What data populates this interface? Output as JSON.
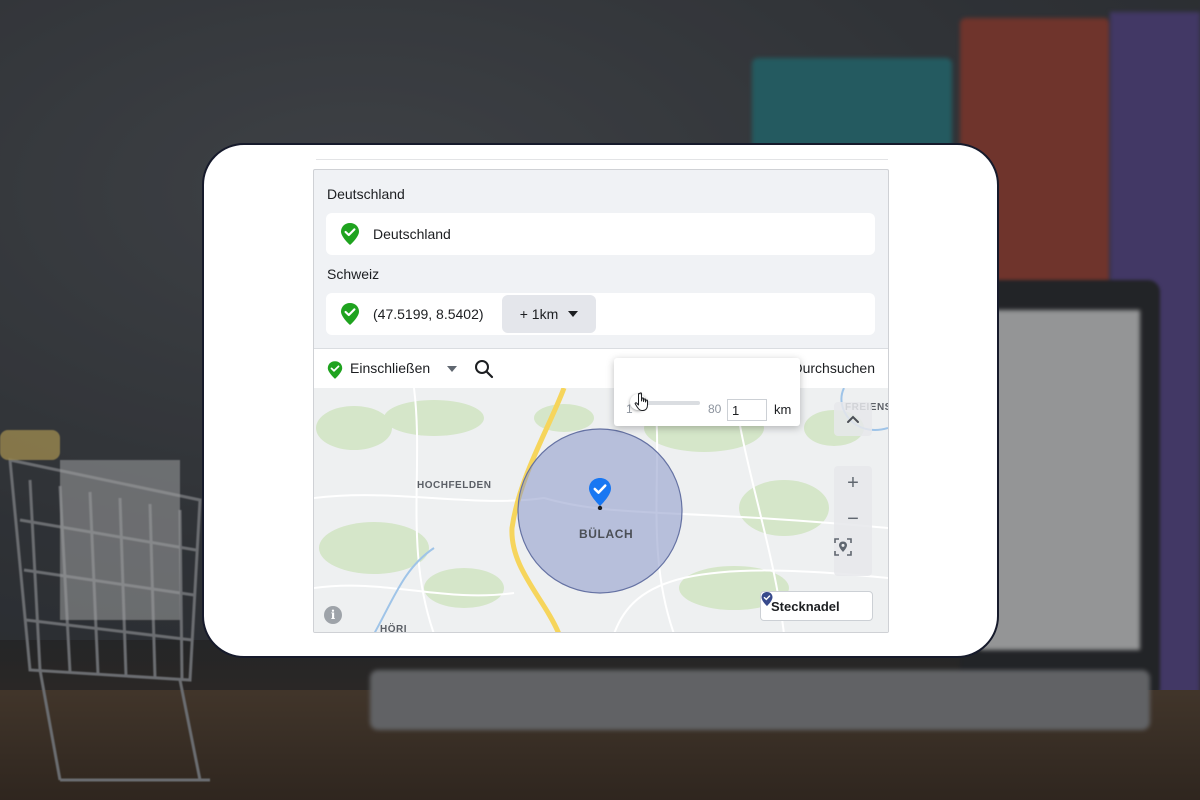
{
  "sections": [
    {
      "label": "Deutschland",
      "location": "Deutschland"
    },
    {
      "label": "Schweiz",
      "location": "(47.5199, 8.5402)",
      "radius_label": "+ 1km"
    }
  ],
  "toolbar": {
    "include_label": "Einschließen",
    "browse_label": "Durchsuchen"
  },
  "radius_popover": {
    "min": "1",
    "max": "80",
    "value": "1",
    "unit": "km",
    "slider_fraction": 0
  },
  "map": {
    "labels": {
      "hochfelden": "HOCHFELDEN",
      "freienstein": "FREIENS",
      "hoeri": "HÖRI",
      "city": "BÜLACH"
    },
    "zoom_in": "+",
    "zoom_out": "−",
    "info": "i",
    "pin_button_label": "Stecknadel"
  },
  "colors": {
    "include_green": "#1fa31f",
    "pin_blue": "#1877f2",
    "radius_fill": "#8b98c9",
    "road_yellow": "#f6d55c"
  },
  "icons": {
    "location": "location-check-icon",
    "search": "search-icon",
    "pin": "map-pin-icon",
    "locate": "locate-icon"
  }
}
